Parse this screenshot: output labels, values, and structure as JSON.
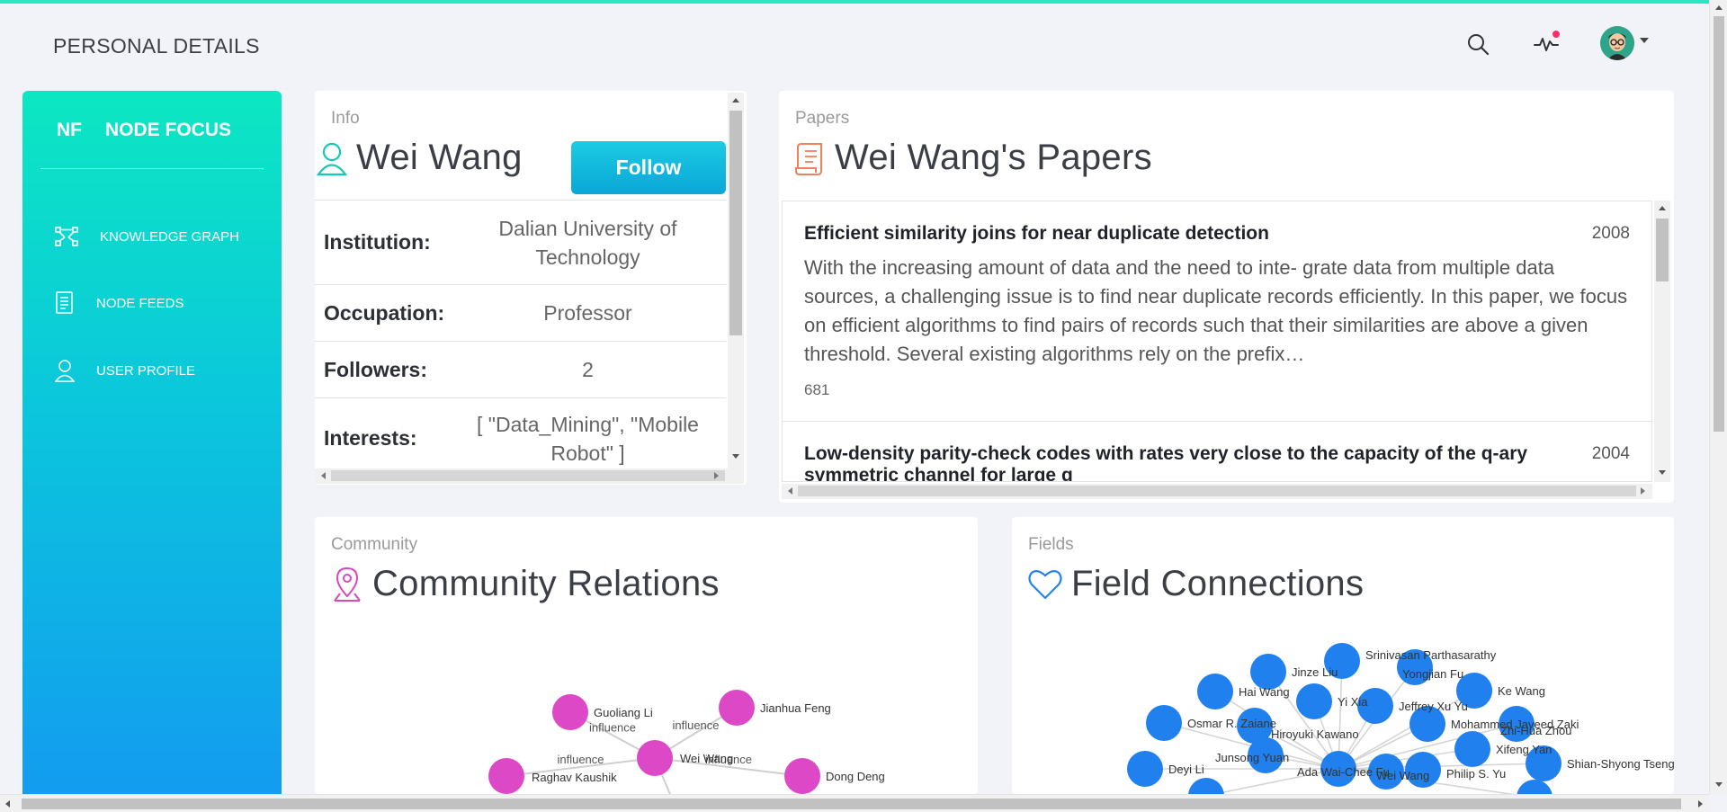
{
  "header": {
    "title": "PERSONAL DETAILS"
  },
  "sidebar": {
    "brand_short": "NF",
    "brand_name": "NODE FOCUS",
    "items": [
      {
        "label": "KNOWLEDGE GRAPH",
        "icon": "graph-icon"
      },
      {
        "label": "NODE FEEDS",
        "icon": "feed-icon"
      },
      {
        "label": "USER PROFILE",
        "icon": "user-icon"
      }
    ]
  },
  "info": {
    "label": "Info",
    "name": "Wei Wang",
    "follow_label": "Follow",
    "rows": [
      {
        "key": "Institution:",
        "value": "Dalian University of Technology"
      },
      {
        "key": "Occupation:",
        "value": "Professor"
      },
      {
        "key": "Followers:",
        "value": "2"
      },
      {
        "key": "Interests:",
        "value": "[ \"Data_Mining\", \"Mobile Robot\" ]"
      }
    ]
  },
  "papers": {
    "label": "Papers",
    "heading": "Wei Wang's Papers",
    "items": [
      {
        "title": "Efficient similarity joins for near duplicate detection",
        "year": "2008",
        "abstract": "With the increasing amount of data and the need to inte- grate data from multiple data sources, a challenging issue is to find near duplicate records efficiently. In this paper, we focus on efficient algorithms to find pairs of records such that their similarities are above a given threshold. Several existing algorithms rely on the prefix…",
        "citations": "681"
      },
      {
        "title": "Low-density parity-check codes with rates very close to the capacity of the q-ary symmetric channel for large q",
        "year": "2004",
        "abstract": "",
        "citations": ""
      }
    ]
  },
  "community": {
    "label": "Community",
    "heading": "Community Relations",
    "edge_label": "influence",
    "nodes": [
      {
        "name": "Guoliang Li"
      },
      {
        "name": "Jianhua Feng"
      },
      {
        "name": "Wei Wang"
      },
      {
        "name": "Dong Deng"
      },
      {
        "name": "Raghav Kaushik"
      }
    ]
  },
  "fields": {
    "label": "Fields",
    "heading": "Field Connections",
    "nodes": [
      {
        "name": "Srinivasan Parthasarathy"
      },
      {
        "name": "Yongjian Fu"
      },
      {
        "name": "Jinze Liu"
      },
      {
        "name": "Hai Wang"
      },
      {
        "name": "Yi Xia"
      },
      {
        "name": "Jeffrey Xu Yu"
      },
      {
        "name": "Ke Wang"
      },
      {
        "name": "Osmar R. Zaiane"
      },
      {
        "name": "Hiroyuki Kawano"
      },
      {
        "name": "Mohammed Javeed Zaki"
      },
      {
        "name": "Zhi-Hua Zhou"
      },
      {
        "name": "Junsong Yuan"
      },
      {
        "name": "Xifeng Yan"
      },
      {
        "name": "Deyi Li"
      },
      {
        "name": "Ada Wai-Chee Fu"
      },
      {
        "name": "Wei Wang"
      },
      {
        "name": "Philip S. Yu"
      },
      {
        "name": "Shian-Shyong Tseng"
      }
    ]
  },
  "colors": {
    "accent": "#0ce7c2",
    "community_node": "#dd48c6",
    "field_node": "#2080ee"
  }
}
